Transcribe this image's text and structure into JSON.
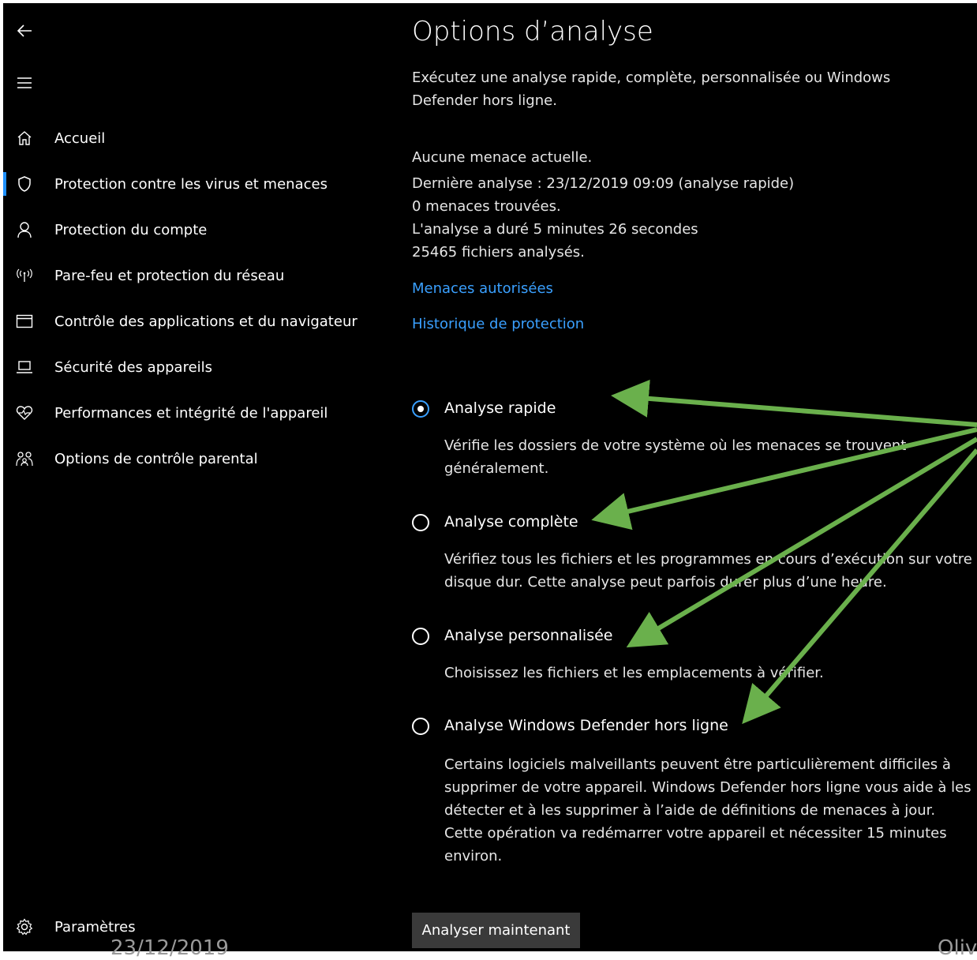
{
  "nav": {
    "items": [
      {
        "label": "Accueil",
        "icon": "home-icon"
      },
      {
        "label": "Protection contre les virus et menaces",
        "icon": "shield-icon",
        "active": true
      },
      {
        "label": "Protection du compte",
        "icon": "person-icon"
      },
      {
        "label": "Pare-feu et protection du réseau",
        "icon": "wifi-antenna-icon"
      },
      {
        "label": "Contrôle des applications et du navigateur",
        "icon": "browser-window-icon"
      },
      {
        "label": "Sécurité des appareils",
        "icon": "laptop-icon"
      },
      {
        "label": "Performances et intégrité de l'appareil",
        "icon": "heart-icon"
      },
      {
        "label": "Options de contrôle parental",
        "icon": "family-icon"
      }
    ],
    "settings_label": "Paramètres"
  },
  "main": {
    "title": "Options d’analyse",
    "description": "Exécutez une analyse rapide, complète, personnalisée ou Windows Defender hors ligne.",
    "status": [
      "Aucune menace actuelle.",
      "Dernière analyse : 23/12/2019 09:09 (analyse rapide)",
      "0 menaces trouvées.",
      "L'analyse a duré 5 minutes 26 secondes",
      "25465 fichiers analysés."
    ],
    "links": {
      "allowed_threats": "Menaces autorisées",
      "protection_history": "Historique de protection"
    },
    "options": [
      {
        "label": "Analyse rapide",
        "description": "Vérifie les dossiers de votre système où les menaces se trouvent généralement.",
        "selected": true
      },
      {
        "label": "Analyse complète",
        "description": "Vérifiez tous les fichiers et les programmes en cours d’exécution sur votre disque dur. Cette analyse peut parfois durer plus d’une heure.",
        "selected": false
      },
      {
        "label": "Analyse personnalisée",
        "description": "Choisissez les fichiers et les emplacements à vérifier.",
        "selected": false
      },
      {
        "label": "Analyse Windows Defender hors ligne",
        "description": "Certains logiciels malveillants peuvent être particulièrement difficiles à supprimer de votre appareil. Windows Defender hors ligne vous aide à les détecter et à les supprimer à l’aide de définitions de menaces à jour. Cette opération va redémarrer votre appareil et nécessiter 15 minutes environ.",
        "selected": false
      }
    ],
    "scan_button": "Analyser maintenant"
  },
  "footer": {
    "date": "23/12/2019",
    "right_text": "Oliv"
  },
  "colors": {
    "background": "#000000",
    "accent": "#3aa0ff",
    "arrow": "#6ab04c"
  }
}
